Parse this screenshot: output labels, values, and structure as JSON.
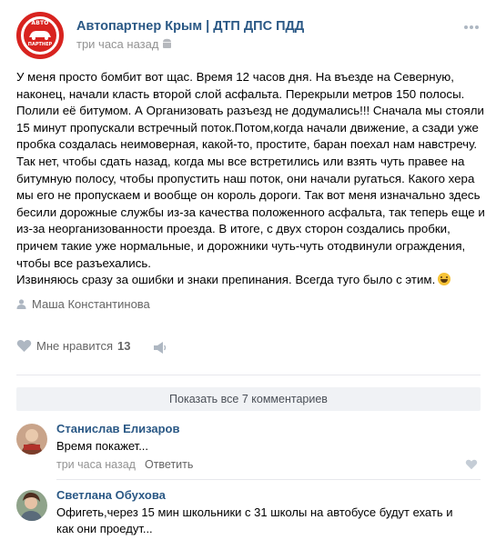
{
  "header": {
    "group_name": "Автопартнер Крым | ДТП ДПС ПДД",
    "time": "три часа назад",
    "logo_top": "АВТО",
    "logo_bottom": "ПАРТНЕР"
  },
  "post": {
    "lines": [
      "У меня просто бомбит вот щас. Время 12 часов дня. На въезде на Северную,",
      "наконец, начали класть второй слой асфальта. Перекрыли метров 150 полосы.",
      "Полили её битумом. А Организовать разъезд не додумались!!! Сначала мы стояли",
      "15 минут пропускали встречный поток.Потом,когда начали движение, а сзади уже",
      "пробка создалась неимоверная, какой-то, простите, баран поехал нам навстречу.",
      "Так нет, чтобы сдать назад, когда мы все встретились или взять чуть правее на",
      "битумную полосу, чтобы пропустить наш поток, они начали ругаться. Какого хера",
      "мы его не пропускаем и вообще он король дороги. Так вот меня изначально здесь",
      "бесили дорожные службы из-за качества положенного асфальта, так теперь еще и",
      "из-за неорганизованности проезда. В итоге, с двух сторон создались пробки,",
      "причем такие уже нормальные, и дорожники чуть-чуть отодвинули ограждения,",
      "чтобы все разъехались.",
      "Извиняюсь сразу за ошибки и знаки препинания. Всегда туго было с этим."
    ],
    "signer": "Маша Константинова"
  },
  "actions": {
    "like_label": "Мне нравится",
    "like_count": "13"
  },
  "show_all_comments": "Показать все 7 комментариев",
  "comments": [
    {
      "name": "Станислав Елизаров",
      "text": "Время покажет...",
      "time": "три часа назад",
      "reply": "Ответить"
    },
    {
      "name": "Светлана Обухова",
      "text": "Офигеть,через 15 мин школьники с 31 школы на автобусе будут ехать и как они проедут..."
    }
  ],
  "colors": {
    "link": "#2a5885",
    "muted": "#939393",
    "brand_red": "#d8231f"
  }
}
